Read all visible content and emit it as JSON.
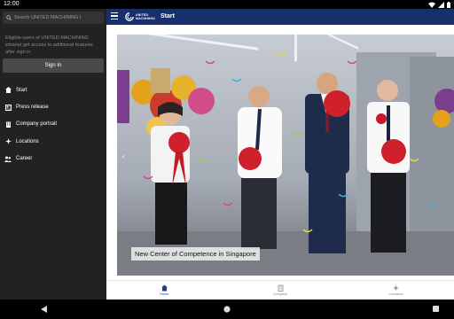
{
  "status": {
    "time": "12:00"
  },
  "drawer": {
    "search_placeholder": "Search UNITED MACHINING I",
    "info": "Eligible users of UNITED MACHINING intranet get access to additional features after sign in",
    "signin_label": "Sign In",
    "menu": [
      {
        "label": "Start",
        "icon": "home-icon"
      },
      {
        "label": "Press release",
        "icon": "newspaper-icon"
      },
      {
        "label": "Company portrait",
        "icon": "building-icon"
      },
      {
        "label": "Locations",
        "icon": "compass-icon"
      },
      {
        "label": "Career",
        "icon": "people-icon"
      }
    ]
  },
  "appbar": {
    "logo_line1": "UNITED",
    "logo_line2": "MACHINING",
    "title": "Start"
  },
  "hero": {
    "caption": "New Center of Competence in Singapore"
  },
  "tabs": [
    {
      "label": "Home",
      "icon": "home-icon",
      "active": true
    },
    {
      "label": "Company",
      "icon": "building-icon",
      "active": false
    },
    {
      "label": "Locations",
      "icon": "compass-icon",
      "active": false
    }
  ],
  "colors": {
    "appbar": "#17306c",
    "drawer": "#222222",
    "tab_active": "#1f3f8c"
  }
}
